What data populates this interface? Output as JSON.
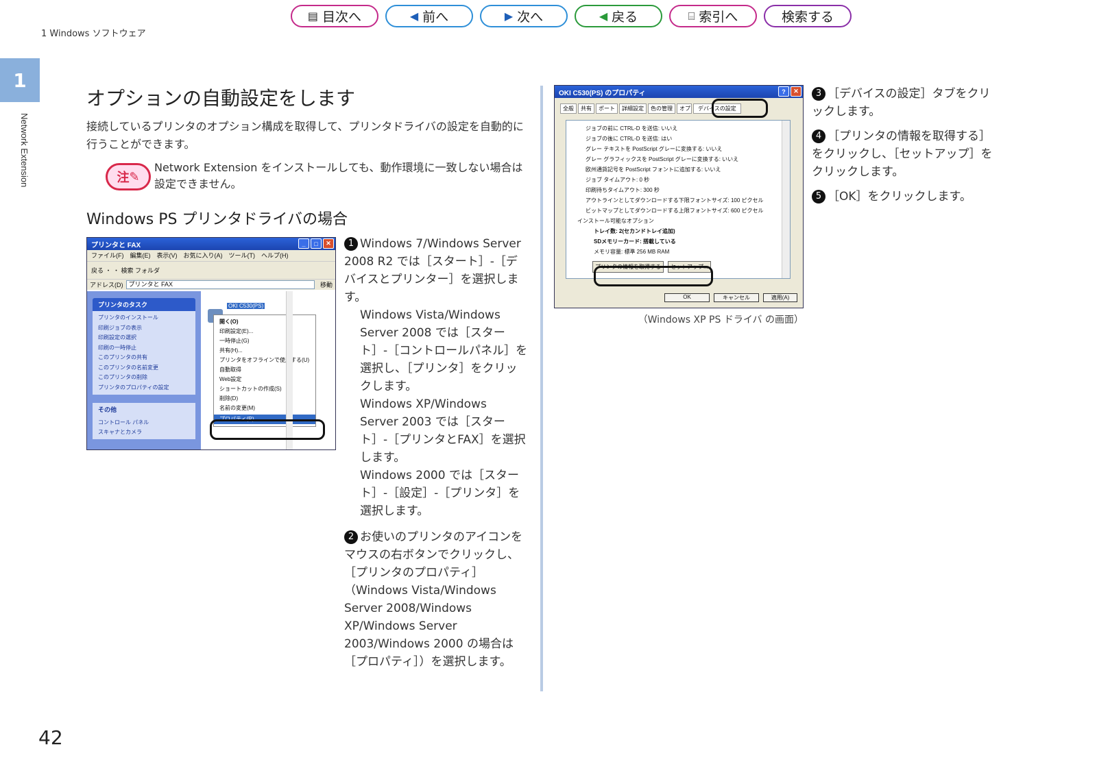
{
  "nav": {
    "toc": "目次へ",
    "prev": "前へ",
    "next": "次へ",
    "back": "戻る",
    "index": "索引へ",
    "search": "検索する",
    "colors": {
      "magenta": "#c4298a",
      "blue": "#2e8fd8",
      "green": "#2a9a3a",
      "purple": "#8a2ea8"
    }
  },
  "header": {
    "breadcrumb": "1 Windows ソフトウェア",
    "chapter_num": "1",
    "side_label": "Network Extension"
  },
  "title": "オプションの自動設定をします",
  "intro": "接続しているプリンタのオプション構成を取得して、プリンタドライバの設定を自動的に行うことができます。",
  "note": {
    "badge": "注",
    "text": "Network Extension をインストールしても、動作環境に一致しない場合は設定できません。"
  },
  "subtitle": "Windows PS プリンタドライバの場合",
  "shot1": {
    "title": "プリンタと FAX",
    "menubar": "ファイル(F)　編集(E)　表示(V)　お気に入り(A)　ツール(T)　ヘルプ(H)",
    "toolbar": "戻る ・ ・ 検索 フォルダ",
    "address_label": "アドレス(D)",
    "address_value": "プリンタと FAX",
    "go": "移動",
    "tasks_header": "プリンタのタスク",
    "tasks": [
      "プリンタのインストール",
      "印刷ジョブの表示",
      "印刷設定の選択",
      "印刷の一時停止",
      "このプリンタの共有",
      "このプリンタの名前変更",
      "このプリンタの削除",
      "プリンタのプロパティの設定"
    ],
    "other_header": "その他",
    "other": [
      "コントロール パネル",
      "スキャナとカメラ"
    ],
    "printer_label": "OKI C530(PS)",
    "context_menu": [
      "開く(O)",
      "印刷設定(E)...",
      "一時停止(G)",
      "共有(H)...",
      "プリンタをオフラインで使用する(U)",
      "自動取得",
      "Web設定",
      "ショートカットの作成(S)",
      "削除(D)",
      "名前の変更(M)",
      "プロパティ(R)"
    ]
  },
  "steps_left": {
    "s1": "Windows 7/Windows Server 2008 R2 では［スタート］-［デバイスとプリンター］を選択します。",
    "s1b": "Windows Vista/Windows Server 2008 では［スタート］-［コントロールパネル］を選択し、［プリンタ］をクリックします。",
    "s1c": "Windows XP/Windows Server 2003 では［スタート］-［プリンタとFAX］を選択します。",
    "s1d": "Windows 2000 では［スタート］-［設定］-［プリンタ］を選択します。",
    "s2": "お使いのプリンタのアイコンをマウスの右ボタンでクリックし、［プリンタのプロパティ］（Windows Vista/Windows Server 2008/Windows XP/Windows Server 2003/Windows 2000 の場合は［プロパティ］）を選択します。"
  },
  "shot2": {
    "title": "OKI C530(PS) のプロパティ",
    "tabs": [
      "全般",
      "共有",
      "ポート",
      "詳細設定",
      "色の管理",
      "オプション",
      "デバイスの設定"
    ],
    "rows": [
      "ジョブの前に CTRL-D を送信: いいえ",
      "ジョブの後に CTRL-D を送信: はい",
      "グレー テキストを PostScript グレーに変換する: いいえ",
      "グレー グラフィックスを PostScript グレーに変換する: いいえ",
      "欧州通貨記号を PostScript フォントに追加する: いいえ",
      "ジョブ タイムアウト: 0 秒",
      "印刷待ちタイムアウト: 300 秒",
      "アウトラインとしてダウンロードする下限フォントサイズ: 100 ピクセル",
      "ビットマップとしてダウンロードする上限フォントサイズ: 600 ピクセル",
      "インストール可能なオプション",
      "トレイ数: 2(セカンドトレイ追加)",
      "SDメモリーカード: 搭載している",
      "メモリ容量: 標準 256 MB RAM"
    ],
    "get_info": "プリンタの情報を取得する",
    "setup": "セットアップ...",
    "ok": "OK",
    "cancel": "キャンセル",
    "apply": "適用(A)",
    "caption": "（Windows XP PS ドライバ の画面）"
  },
  "steps_right": {
    "s3": "［デバイスの設定］タブをクリックします。",
    "s4": "［プリンタの情報を取得する］をクリックし、［セットアップ］をクリックします。",
    "s5": "［OK］をクリックします。"
  },
  "footer": {
    "page": "42"
  }
}
